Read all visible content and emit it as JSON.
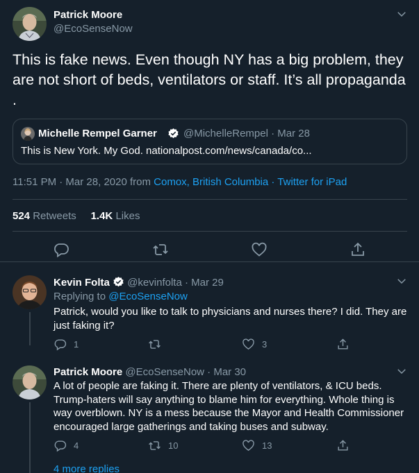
{
  "main_tweet": {
    "author_name": "Patrick Moore",
    "author_handle": "@EcoSenseNow",
    "text": "This is fake news. Even though NY has a big problem, they are not short of beds, ventilators or staff. It’s all propaganda .",
    "quote": {
      "author_name": "Michelle Rempel Garner",
      "meta": "@MichelleRempel · Mar 28",
      "text": "This is New York. My God.  nationalpost.com/news/canada/co..."
    },
    "timestamp": "11:51 PM · Mar 28, 2020 from ",
    "location": "Comox, British Columbia",
    "separator": " · ",
    "source": "Twitter for iPad",
    "retweets_count": "524",
    "retweets_label": "Retweets",
    "likes_count": "1.4K",
    "likes_label": "Likes"
  },
  "replies": [
    {
      "author_name": "Kevin Folta",
      "meta": "@kevinfolta · Mar 29",
      "replying_prefix": "Replying to ",
      "replying_handle": "@EcoSenseNow",
      "text": "Patrick, would you like to talk to physicians and nurses there? I did.  They are just faking it?",
      "reply_count": "1",
      "retweet_count": "",
      "like_count": "3"
    },
    {
      "author_name": "Patrick Moore",
      "meta": "@EcoSenseNow · Mar 30",
      "text": "A lot of people are faking it. There are plenty of ventilators, & ICU beds. Trump-haters will say anything to blame him for everything. Whole thing is way overblown. NY is a mess because the Mayor and Health Commissioner encouraged large gatherings and taking buses and subway.",
      "reply_count": "4",
      "retweet_count": "10",
      "like_count": "13"
    }
  ],
  "more_replies": "4 more replies",
  "colors": {
    "background": "#15202b",
    "secondary_text": "#8899a6",
    "accent": "#1da1f2",
    "border": "#38444d"
  },
  "icons": {
    "reply": "reply-icon",
    "retweet": "retweet-icon",
    "like": "heart-icon",
    "share": "share-icon",
    "more": "chevron-down-icon",
    "verified": "verified-badge-icon"
  }
}
